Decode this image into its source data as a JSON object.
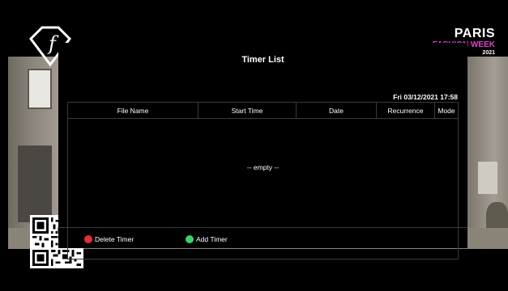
{
  "dialog": {
    "title": "Timer List",
    "datetime": "Fri 03/12/2021 17:58"
  },
  "table": {
    "columns": [
      "File Name",
      "Start Time",
      "Date",
      "Recurrence",
      "Mode"
    ],
    "empty_text": "-- empty --"
  },
  "footer": {
    "delete_label": "Delete Timer",
    "delete_color": "#e0303a",
    "add_label": "Add Timer",
    "add_color": "#3ed16a"
  },
  "brand": {
    "line1": "PARIS",
    "line2": "FASHION WEEK",
    "line3": "2021",
    "accent": "#e040c8"
  },
  "icons": {
    "logo": "fashion-tv-logo",
    "qr": "qr-code"
  }
}
